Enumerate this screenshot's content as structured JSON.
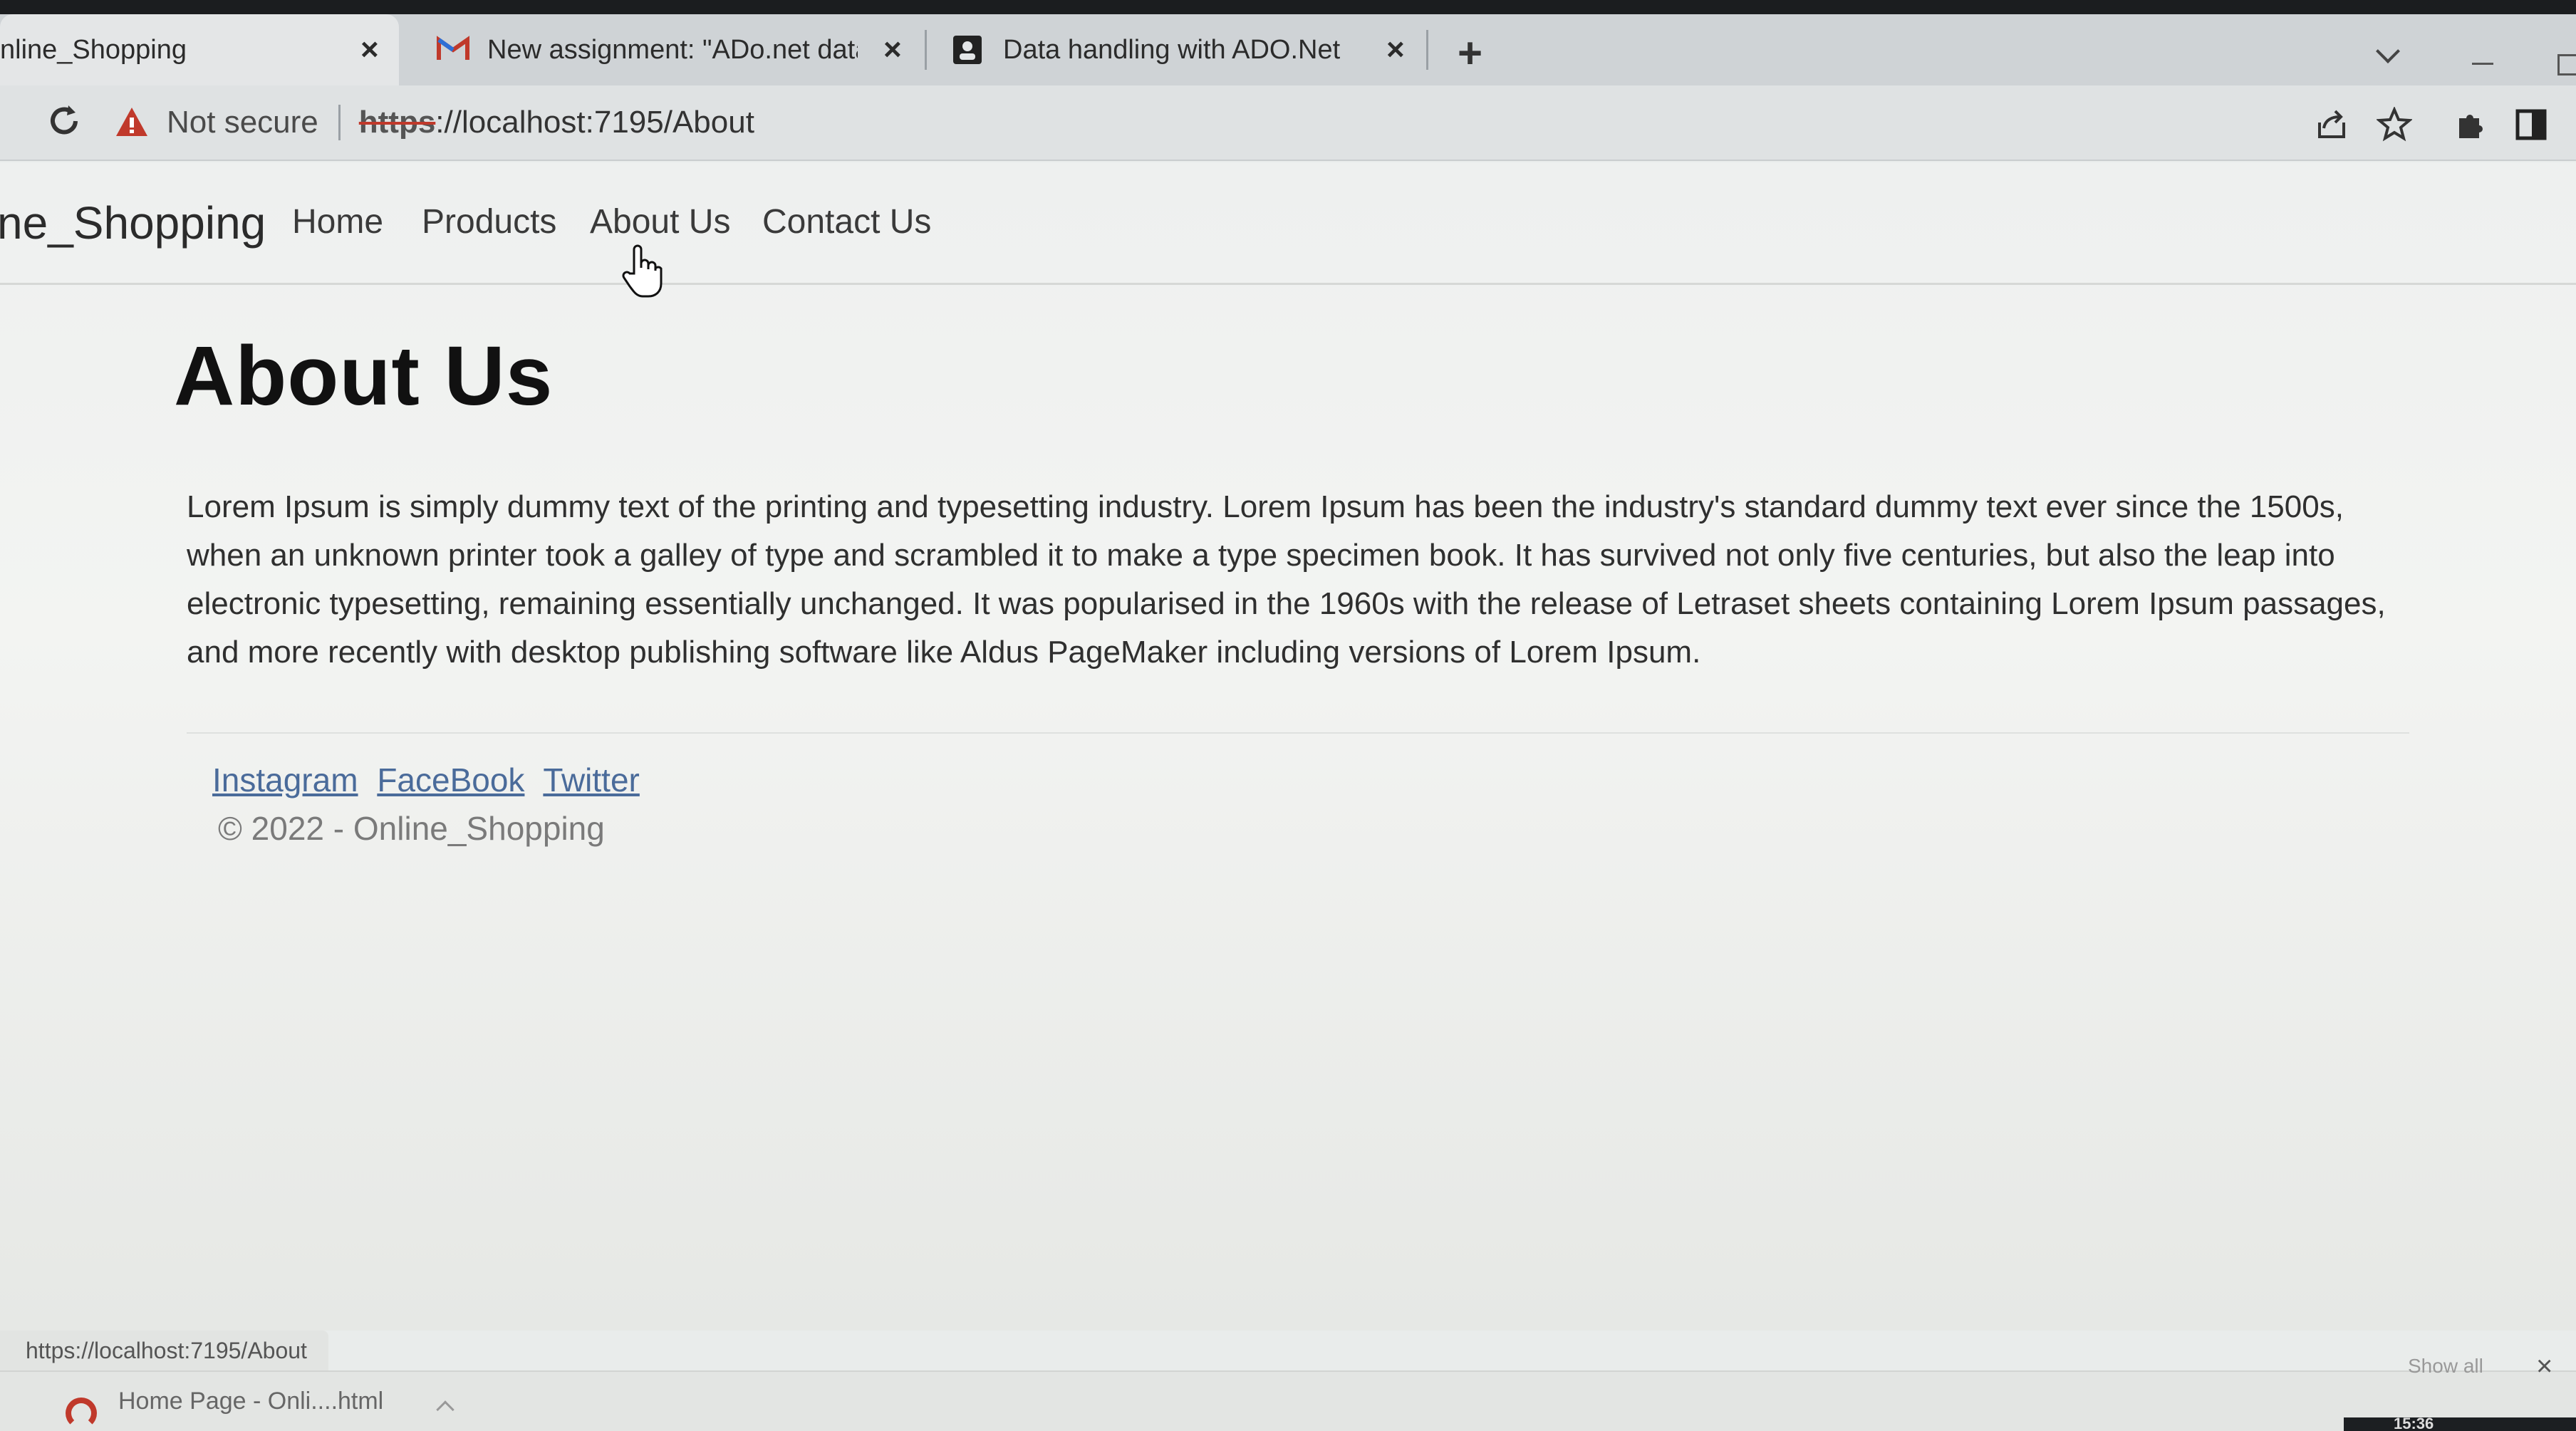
{
  "browser": {
    "tabs": [
      {
        "title": "nline_Shopping",
        "icon": "none"
      },
      {
        "title": "New assignment: \"ADo.net data",
        "icon": "gmail-icon"
      },
      {
        "title": "Data handling with ADO.Net",
        "icon": "classroom-icon"
      }
    ],
    "new_tab_label": "+",
    "security_label": "Not secure",
    "url_scheme": "https",
    "url_rest": "://localhost:7195/About"
  },
  "site": {
    "brand": "ne_Shopping",
    "nav": [
      "Home",
      "Products",
      "About Us",
      "Contact Us"
    ]
  },
  "content": {
    "heading": "About Us",
    "paragraph": "Lorem Ipsum is simply dummy text of the printing and typesetting industry. Lorem Ipsum has been the industry's standard dummy text ever since the 1500s, when an unknown printer took a galley of type and scrambled it to make a type specimen book. It has survived not only five centuries, but also the leap into electronic typesetting, remaining essentially unchanged. It was popularised in the 1960s with the release of Letraset sheets containing Lorem Ipsum passages, and more recently with desktop publishing software like Aldus PageMaker including versions of Lorem Ipsum."
  },
  "footer": {
    "links": [
      "Instagram",
      "FaceBook",
      "Twitter"
    ],
    "copyright": "© 2022 - Online_Shopping"
  },
  "status": {
    "hover_url": "https://localhost:7195/About",
    "download_name": "Home Page - Onli....html",
    "show_all": "Show all",
    "clock": "15:36"
  }
}
